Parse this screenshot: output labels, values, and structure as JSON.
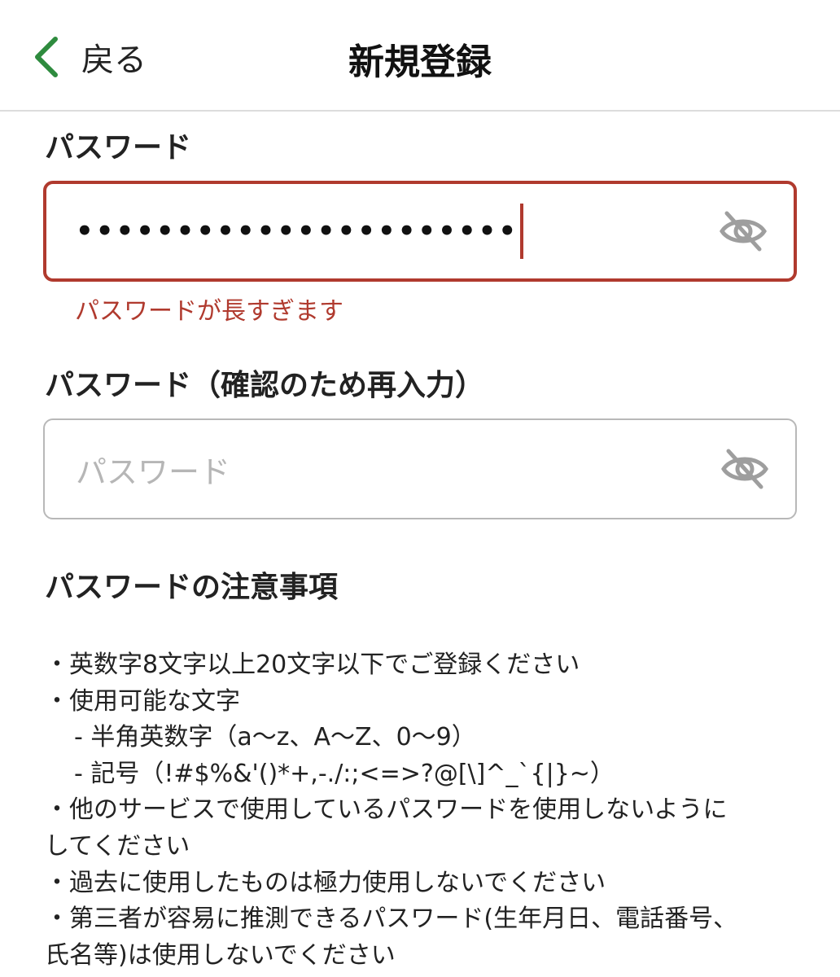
{
  "header": {
    "back_label": "戻る",
    "title": "新規登録"
  },
  "password": {
    "label": "パスワード",
    "value": "••••••••••••••••••••••",
    "error": "パスワードが長すぎます"
  },
  "confirm": {
    "label": "パスワード（確認のため再入力）",
    "placeholder": "パスワード"
  },
  "notes": {
    "title": "パスワードの注意事項",
    "lines": [
      "・英数字8文字以上20文字以下でご登録ください",
      "・使用可能な文字",
      "- 半角英数字（a〜z、A〜Z、0〜9）",
      "- 記号（!#$%&'()*+,-./:;<=>?@[\\]^_`{|}~）",
      "・他のサービスで使用しているパスワードを使用しないように",
      "してください",
      "・過去に使用したものは極力使用しないでください",
      "・第三者が容易に推測できるパスワード(生年月日、電話番号、",
      "氏名等)は使用しないでください"
    ]
  },
  "icons": {
    "back": "chevron-left-icon",
    "password_toggle": "eye-slash-icon",
    "confirm_toggle": "eye-slash-icon"
  },
  "colors": {
    "accent": "#2e8b3e",
    "error": "#b03a2e",
    "placeholder": "#b6b6b6",
    "icon": "#9e9e9e"
  }
}
